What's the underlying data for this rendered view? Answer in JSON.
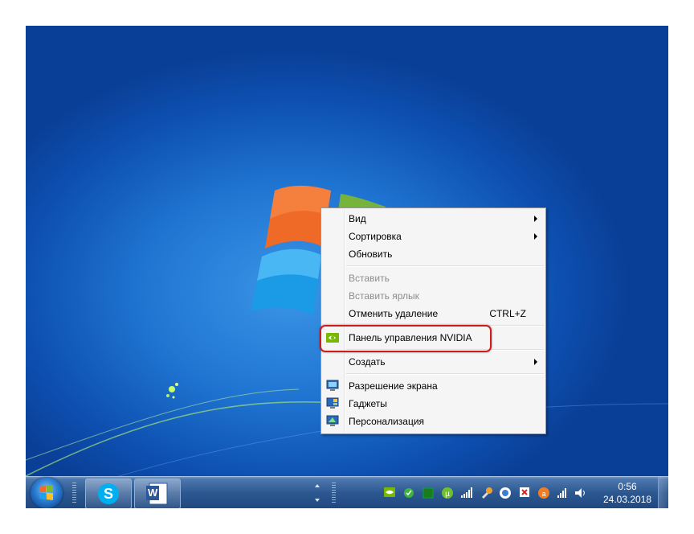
{
  "context_menu": {
    "items": [
      {
        "label": "Вид"
      },
      {
        "label": "Сортировка"
      },
      {
        "label": "Обновить"
      },
      {
        "label": "Вставить"
      },
      {
        "label": "Вставить ярлык"
      },
      {
        "label": "Отменить удаление",
        "shortcut": "CTRL+Z"
      },
      {
        "label": "Панель управления NVIDIA"
      },
      {
        "label": "Создать"
      },
      {
        "label": "Разрешение экрана"
      },
      {
        "label": "Гаджеты"
      },
      {
        "label": "Персонализация"
      }
    ]
  },
  "taskbar": {
    "word_button_letter": "W",
    "clock_time": "0:56",
    "clock_date": "24.03.2018"
  },
  "icons": {
    "start": "windows-start-orb-icon",
    "skype": "skype-icon",
    "word": "microsoft-word-icon",
    "nvidia": "nvidia-icon"
  },
  "colors": {
    "desktop_blue": "#1f74d1",
    "highlight_red": "#d21a1a",
    "menu_bg": "#f5f5f5"
  }
}
